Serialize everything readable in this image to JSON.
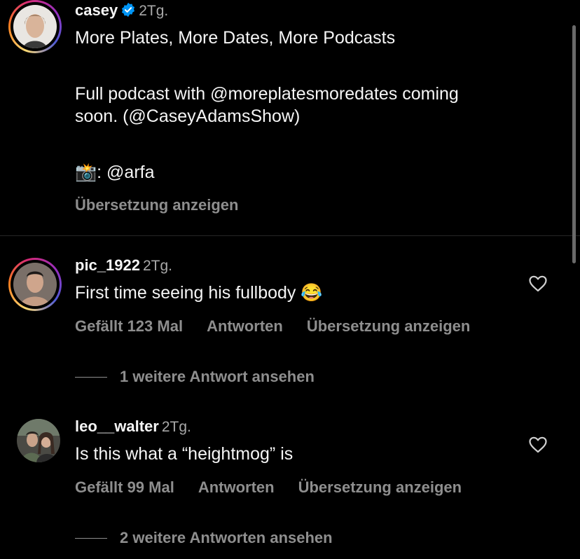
{
  "caption": {
    "username": "casey",
    "time": "2Tg.",
    "line1": "More Plates, More Dates, More Podcasts",
    "line2": "Full podcast with @moreplatesmoredates coming\nsoon. (@CaseyAdamsShow)",
    "camera_emoji": "📸",
    "line3": ": @arfa",
    "translate": "Übersetzung anzeigen"
  },
  "comments": [
    {
      "username": "pic_1922",
      "time": "2Tg.",
      "text": "First time seeing his fullbody 😂",
      "likes": "Gefällt 123 Mal",
      "reply": "Antworten",
      "translate": "Übersetzung anzeigen",
      "more_replies": "1 weitere Antwort ansehen"
    },
    {
      "username": "leo__walter",
      "time": "2Tg.",
      "text": "Is this what a “heightmog” is",
      "likes": "Gefällt 99 Mal",
      "reply": "Antworten",
      "translate": "Übersetzung anzeigen",
      "more_replies": "2 weitere Antworten ansehen"
    }
  ],
  "icons": {
    "verified": "verified-badge-icon",
    "heart": "heart-outline-icon"
  },
  "colors": {
    "background": "#000000",
    "text": "#f5f5f5",
    "muted": "#8e8e8e",
    "verified": "#0095f6"
  }
}
